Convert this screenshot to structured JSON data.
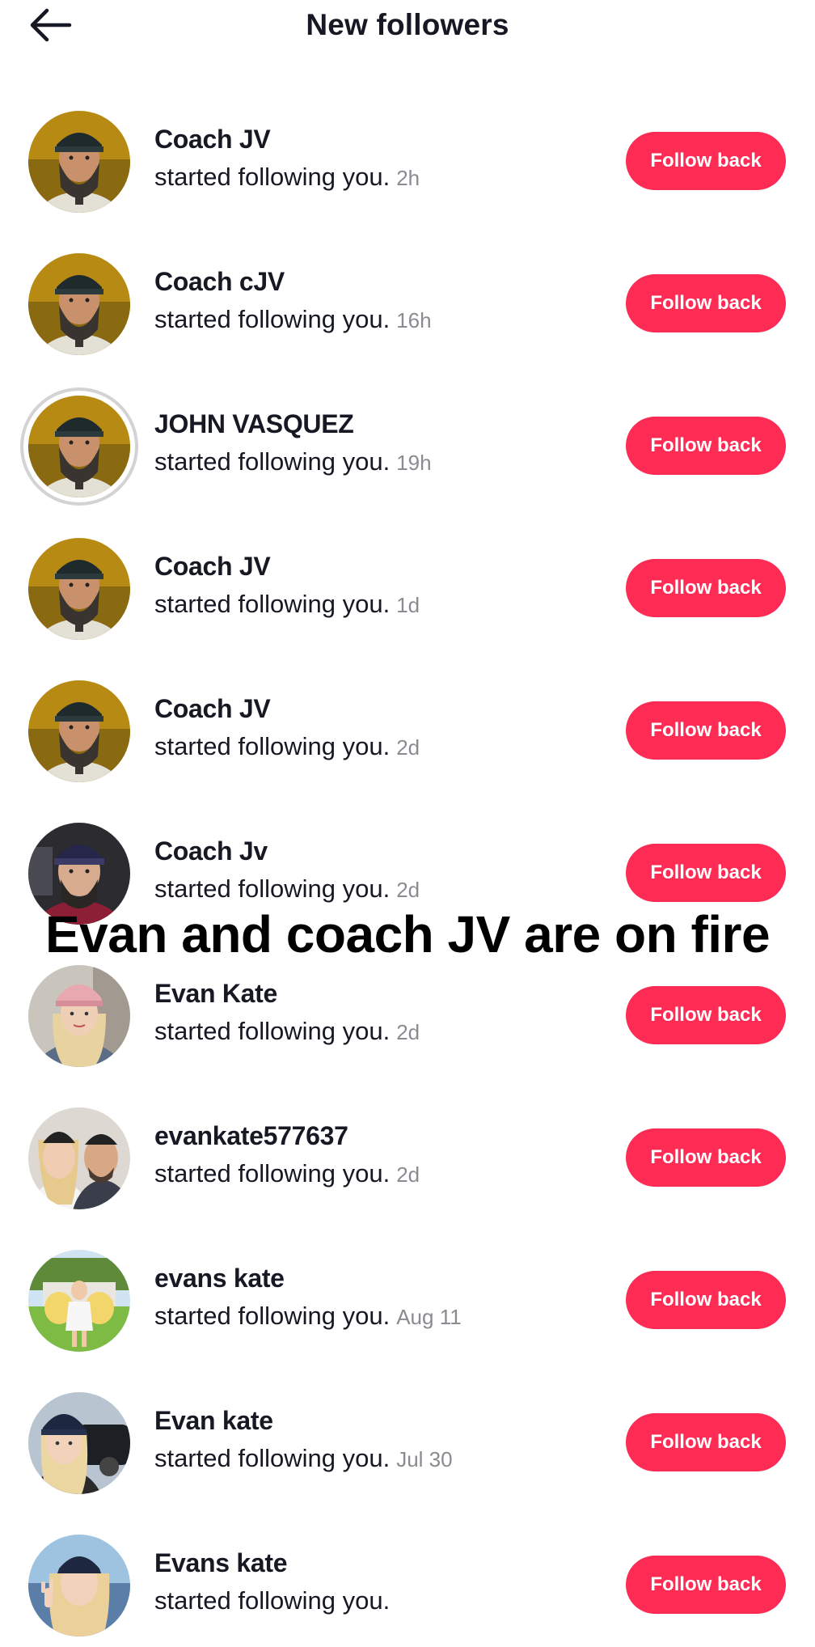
{
  "header": {
    "title": "New followers",
    "back_icon": "arrow-left-icon"
  },
  "caption": "Evan and coach JV are on fire",
  "follow_label": "Follow back",
  "action_text": "started following you.",
  "colors": {
    "accent": "#fe2c55",
    "text": "#161823",
    "muted": "#8a8b91",
    "background": "#ffffff"
  },
  "followers": [
    {
      "name": "Coach JV",
      "time": "2h",
      "avatar": "bearded-man"
    },
    {
      "name": "Coach cJV",
      "time": "16h",
      "avatar": "bearded-man"
    },
    {
      "name": "JOHN VASQUEZ",
      "time": "19h",
      "avatar": "bearded-man"
    },
    {
      "name": "Coach JV",
      "time": "1d",
      "avatar": "bearded-man"
    },
    {
      "name": "Coach JV",
      "time": "2d",
      "avatar": "bearded-man"
    },
    {
      "name": "Coach Jv",
      "time": "2d",
      "avatar": "bearded-man-cap"
    },
    {
      "name": "Evan Kate",
      "time": "2d",
      "avatar": "blonde-woman-cap"
    },
    {
      "name": "evankate577637",
      "time": "2d",
      "avatar": "couple-selfie"
    },
    {
      "name": "evans kate",
      "time": "Aug 11",
      "avatar": "woman-flowers"
    },
    {
      "name": "Evan kate",
      "time": "Jul 30",
      "avatar": "woman-car"
    },
    {
      "name": "Evans kate",
      "time": "",
      "avatar": "woman-peace"
    }
  ]
}
